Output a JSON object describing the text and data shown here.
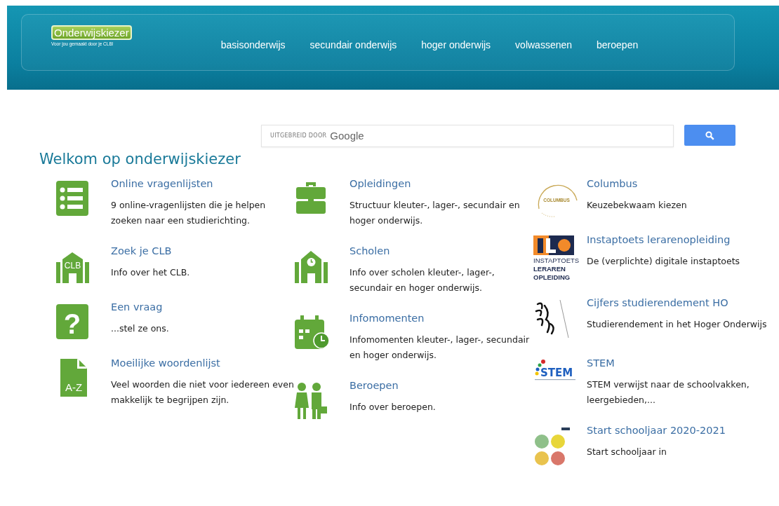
{
  "header": {
    "logo": {
      "title": "Onderwijskiezer",
      "tagline": "Voor jou gemaakt door je CLB!"
    },
    "nav": [
      "basisonderwijs",
      "secundair onderwijs",
      "hoger onderwijs",
      "volwassenen",
      "beroepen"
    ]
  },
  "search": {
    "label": "UITGEBREID DOOR",
    "brand": "Google"
  },
  "heading": "Welkom op onderwijskiezer",
  "columns": [
    {
      "items": [
        {
          "kind": "list",
          "title": "Online vragenlijsten",
          "description": "9 online-vragenlijsten die je helpen zoeken naar een studierichting."
        },
        {
          "kind": "clb",
          "logo_text": "CLB",
          "title": "Zoek je CLB",
          "description": "Info over het CLB."
        },
        {
          "kind": "question",
          "logo_text": "?",
          "title": "Een vraag",
          "description": "...stel ze ons."
        },
        {
          "kind": "document",
          "logo_text": "A-Z",
          "title": "Moeilijke woordenlijst",
          "description": "Veel woorden die niet voor iedereen even makkelijk te begrijpen zijn."
        }
      ]
    },
    {
      "items": [
        {
          "kind": "briefcase",
          "title": "Opleidingen",
          "description": "Structuur kleuter-, lager-, secundair en hoger onderwijs."
        },
        {
          "kind": "school",
          "title": "Scholen",
          "description": "Info over scholen kleuter-, lager-, secundair en hoger onderwijs."
        },
        {
          "kind": "calendar",
          "title": "Infomomenten",
          "description": "Infomomenten kleuter-, lager-, secundair en hoger onderwijs."
        },
        {
          "kind": "people",
          "title": "Beroepen",
          "description": "Info over beroepen."
        }
      ]
    },
    {
      "items": [
        {
          "kind": "columbus",
          "logo_text": "COLUMBUS",
          "title": "Columbus",
          "description": "Keuzebekwaam kiezen"
        },
        {
          "kind": "ilo",
          "logo_text": "INSTAPTOETS LERAREN OPLEIDING",
          "title": "Instaptoets lerarenopleiding",
          "description": "De (verplichte) digitale instaptoets"
        },
        {
          "kind": "lion",
          "title": "Cijfers studierendement HO",
          "description": "Studierendement in het Hoger Onderwijs"
        },
        {
          "kind": "stem",
          "logo_text": "STEM",
          "title": "STEM",
          "description": "STEM verwijst naar de schoolvakken, leergebieden,..."
        },
        {
          "kind": "dots",
          "title": "Start schooljaar 2020-2021",
          "description": "Start schooljaar in"
        }
      ]
    }
  ]
}
